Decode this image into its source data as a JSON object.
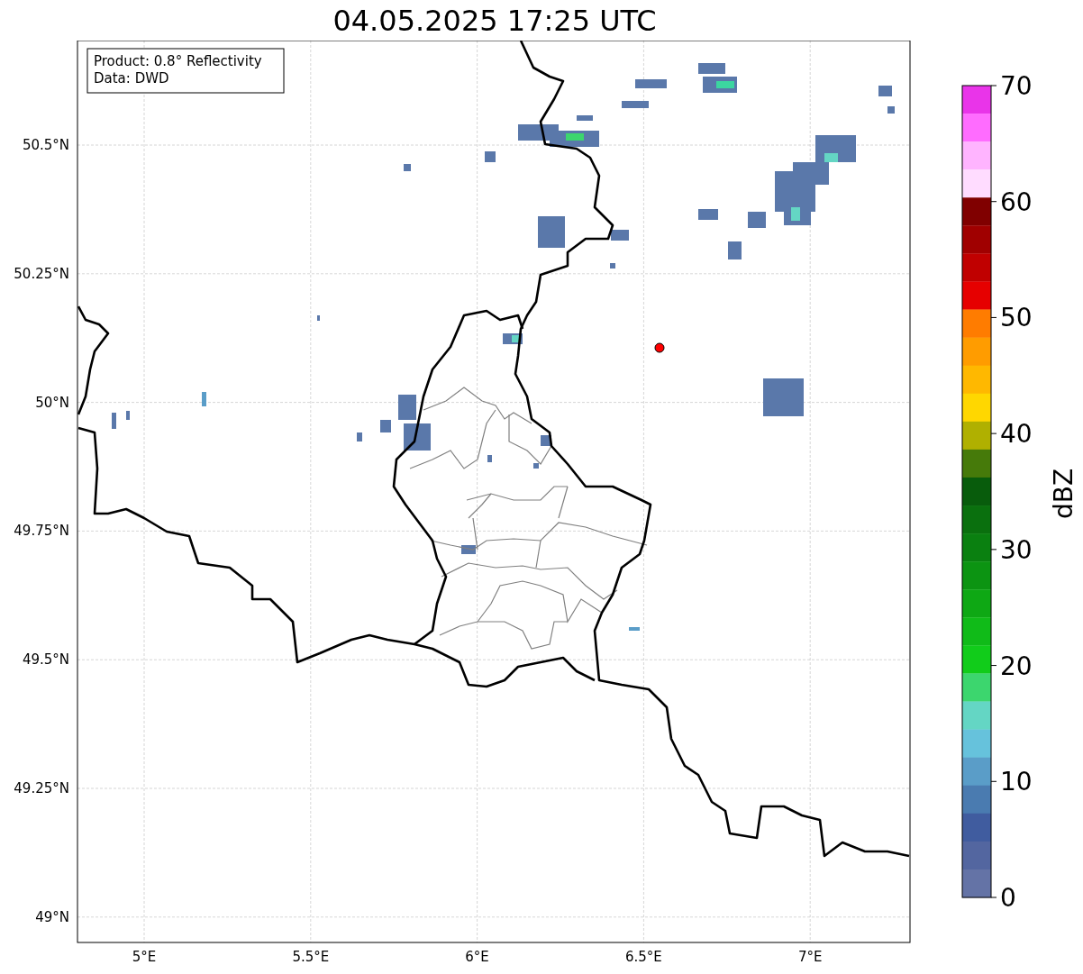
{
  "title": "04.05.2025 17:25 UTC",
  "info_box": [
    "Product: 0.8° Reflectivity",
    "Data: DWD"
  ],
  "lat_labels": [
    "50.5°N",
    "50.25°N",
    "50°N",
    "49.75°N",
    "49.5°N",
    "49.25°N",
    "49°N"
  ],
  "lon_labels": [
    "5°E",
    "5.5°E",
    "6°E",
    "6.5°E",
    "7°E"
  ],
  "colorbar": {
    "label": "dBZ",
    "ticks": [
      "70",
      "60",
      "50",
      "40",
      "30",
      "20",
      "10",
      "0"
    ],
    "segments": [
      {
        "color": "#e934e9"
      },
      {
        "color": "#ff6cff"
      },
      {
        "color": "#ffb4ff"
      },
      {
        "color": "#ffdcff"
      },
      {
        "color": "#800000"
      },
      {
        "color": "#a00000"
      },
      {
        "color": "#c00000"
      },
      {
        "color": "#e60000"
      },
      {
        "color": "#ff7c00"
      },
      {
        "color": "#ff9c00"
      },
      {
        "color": "#ffb800"
      },
      {
        "color": "#ffd700"
      },
      {
        "color": "#b0b000"
      },
      {
        "color": "#467a0a"
      },
      {
        "color": "#085c0c"
      },
      {
        "color": "#0a700e"
      },
      {
        "color": "#0a8010"
      },
      {
        "color": "#0c9412"
      },
      {
        "color": "#0ea814"
      },
      {
        "color": "#10bb18"
      },
      {
        "color": "#11cc1a"
      },
      {
        "color": "#3cd66e"
      },
      {
        "color": "#64d6c4"
      },
      {
        "color": "#66c2dc"
      },
      {
        "color": "#5a9dc8"
      },
      {
        "color": "#4a7bb0"
      },
      {
        "color": "#405c9f"
      },
      {
        "color": "#5366a0"
      },
      {
        "color": "#6473a6"
      }
    ]
  }
}
